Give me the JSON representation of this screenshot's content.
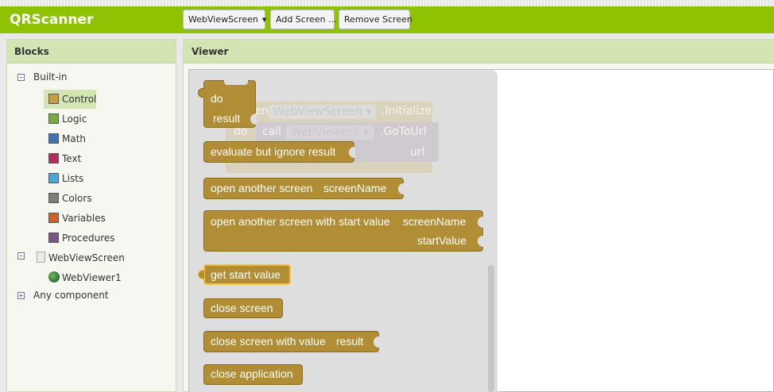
{
  "app": {
    "title": "QRScanner"
  },
  "toolbar": {
    "screen_dropdown": "WebViewScreen",
    "add_screen_label": "Add Screen ...",
    "remove_screen_label": "Remove Screen"
  },
  "blocks_panel": {
    "title": "Blocks",
    "builtin_label": "Built-in",
    "builtin_items": [
      {
        "label": "Control",
        "color": "#c89f3a"
      },
      {
        "label": "Logic",
        "color": "#77ab41"
      },
      {
        "label": "Math",
        "color": "#3f71b5"
      },
      {
        "label": "Text",
        "color": "#b32d5e"
      },
      {
        "label": "Lists",
        "color": "#49a6d4"
      },
      {
        "label": "Colors",
        "color": "#7d7d7d"
      },
      {
        "label": "Variables",
        "color": "#d05f2d"
      },
      {
        "label": "Procedures",
        "color": "#7c5385"
      }
    ],
    "screen_label": "WebViewScreen",
    "component_label": "WebViewer1",
    "any_component_label": "Any component"
  },
  "viewer": {
    "title": "Viewer",
    "ghost": {
      "event_prefix": "when",
      "screen_dropdown": "WebViewScreen",
      "event_name": ".Initialize",
      "do_label": "do",
      "call_label": "call",
      "component_dropdown": "WebViewer1",
      "method_name": ".GoToUrl",
      "arg_label": "url"
    },
    "blocks": {
      "do_label": "do",
      "result_label": "result",
      "evaluate": "evaluate but ignore result",
      "open_screen": "open another screen",
      "screen_name": "screenName",
      "open_screen_with_value": "open another screen with start value",
      "start_value": "startValue",
      "get_start_value": "get start value",
      "close_screen": "close screen",
      "close_screen_with_value": "close screen with value",
      "close_result": "result",
      "close_application": "close application"
    }
  },
  "colors": {
    "brand_green": "#8fc202",
    "panel_header": "#d3e5b3",
    "control_block": "#b18e35"
  }
}
